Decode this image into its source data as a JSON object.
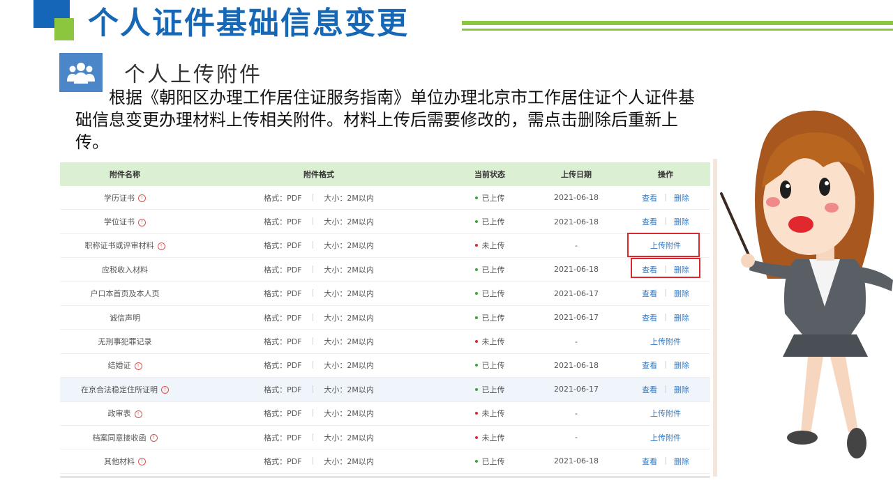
{
  "header": {
    "title": "个人证件基础信息变更",
    "subtitle": "个人上传附件",
    "subtitle_icon": "people-group-icon",
    "intro": "根据《朝阳区办理工作居住证服务指南》单位办理北京市工作居住证个人证件基础信息变更办理材料上传相关附件。材料上传后需要修改的，需点击删除后重新上传。"
  },
  "colors": {
    "title_blue": "#1668b7",
    "accent_green": "#8cc63f",
    "table_header_bg": "#dbefd3",
    "uploaded_dot": "#3aa537",
    "missing_dot": "#d9282f",
    "link_blue": "#2f78c4",
    "highlight_box": "#d9282f"
  },
  "table": {
    "headers": [
      "附件名称",
      "附件格式",
      "当前状态",
      "上传日期",
      "操作"
    ],
    "format_label": "格式：PDF",
    "size_label": "大小：2M以内",
    "rows": [
      {
        "name": "学历证书",
        "warn": true,
        "status": "已上传",
        "uploaded": true,
        "date": "2021-06-18",
        "view": "查看",
        "delete": "删除"
      },
      {
        "name": "学位证书",
        "warn": true,
        "status": "已上传",
        "uploaded": true,
        "date": "2021-06-18",
        "view": "查看",
        "delete": "删除"
      },
      {
        "name": "职称证书或评审材料",
        "warn": true,
        "status": "未上传",
        "uploaded": false,
        "date": "-",
        "upload": "上传附件"
      },
      {
        "name": "应税收入材料",
        "warn": false,
        "status": "已上传",
        "uploaded": true,
        "date": "2021-06-18",
        "view": "查看",
        "delete": "删除"
      },
      {
        "name": "户口本首页及本人页",
        "warn": false,
        "status": "已上传",
        "uploaded": true,
        "date": "2021-06-17",
        "view": "查看",
        "delete": "删除"
      },
      {
        "name": "诚信声明",
        "warn": false,
        "status": "已上传",
        "uploaded": true,
        "date": "2021-06-17",
        "view": "查看",
        "delete": "删除"
      },
      {
        "name": "无刑事犯罪记录",
        "warn": false,
        "status": "未上传",
        "uploaded": false,
        "date": "-",
        "upload": "上传附件"
      },
      {
        "name": "结婚证",
        "warn": true,
        "status": "已上传",
        "uploaded": true,
        "date": "2021-06-18",
        "view": "查看",
        "delete": "删除"
      },
      {
        "name": "在京合法稳定住所证明",
        "warn": true,
        "status": "已上传",
        "uploaded": true,
        "date": "2021-06-17",
        "view": "查看",
        "delete": "删除",
        "highlighted": true
      },
      {
        "name": "政审表",
        "warn": true,
        "status": "未上传",
        "uploaded": false,
        "date": "-",
        "upload": "上传附件"
      },
      {
        "name": "档案同意接收函",
        "warn": true,
        "status": "未上传",
        "uploaded": false,
        "date": "-",
        "upload": "上传附件"
      },
      {
        "name": "其他材料",
        "warn": true,
        "status": "已上传",
        "uploaded": true,
        "date": "2021-06-18",
        "view": "查看",
        "delete": "删除"
      }
    ]
  },
  "illustration": {
    "icon": "presenter-woman-pointer-illustration"
  }
}
